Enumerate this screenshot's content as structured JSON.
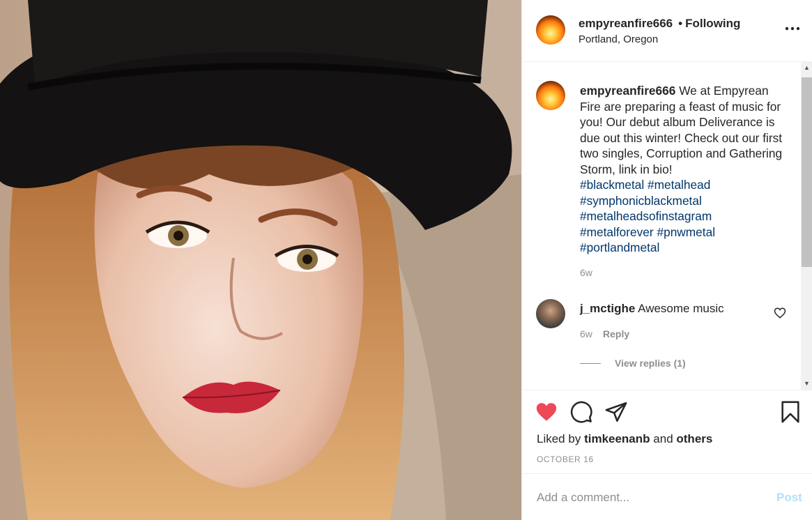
{
  "post": {
    "username": "empyreanfire666",
    "follow_status": "Following",
    "dot": "•",
    "location": "Portland, Oregon"
  },
  "caption": {
    "username": "empyreanfire666",
    "text": "We at Empyrean Fire are preparing a feast of music for you! Our debut album Deliverance is due out this winter! Check out our first two singles, Corruption and Gathering Storm, link in bio!",
    "hashtags": [
      "#blackmetal",
      "#metalhead",
      "#symphonicblackmetal",
      "#metalheadsofinstagram",
      "#metalforever",
      "#pnwmetal",
      "#portlandmetal"
    ],
    "time": "6w"
  },
  "comment": {
    "username": "j_mctighe",
    "text": "Awesome music",
    "time": "6w",
    "reply_label": "Reply",
    "view_replies": "View replies (1)"
  },
  "likes": {
    "prefix": "Liked by",
    "user": "timkeenanb",
    "and": "and",
    "others": "others"
  },
  "date": "OCTOBER 16",
  "add_comment": {
    "placeholder": "Add a comment...",
    "post_label": "Post"
  },
  "icons": {
    "like": "heart-filled-icon",
    "comment": "comment-bubble-icon",
    "share": "paper-plane-icon",
    "save": "bookmark-icon",
    "more": "more-options-icon"
  },
  "colors": {
    "like_red": "#ed4956",
    "hashtag_blue": "#00376b",
    "post_disabled": "#b2dffc",
    "meta_gray": "#8e8e8e"
  }
}
